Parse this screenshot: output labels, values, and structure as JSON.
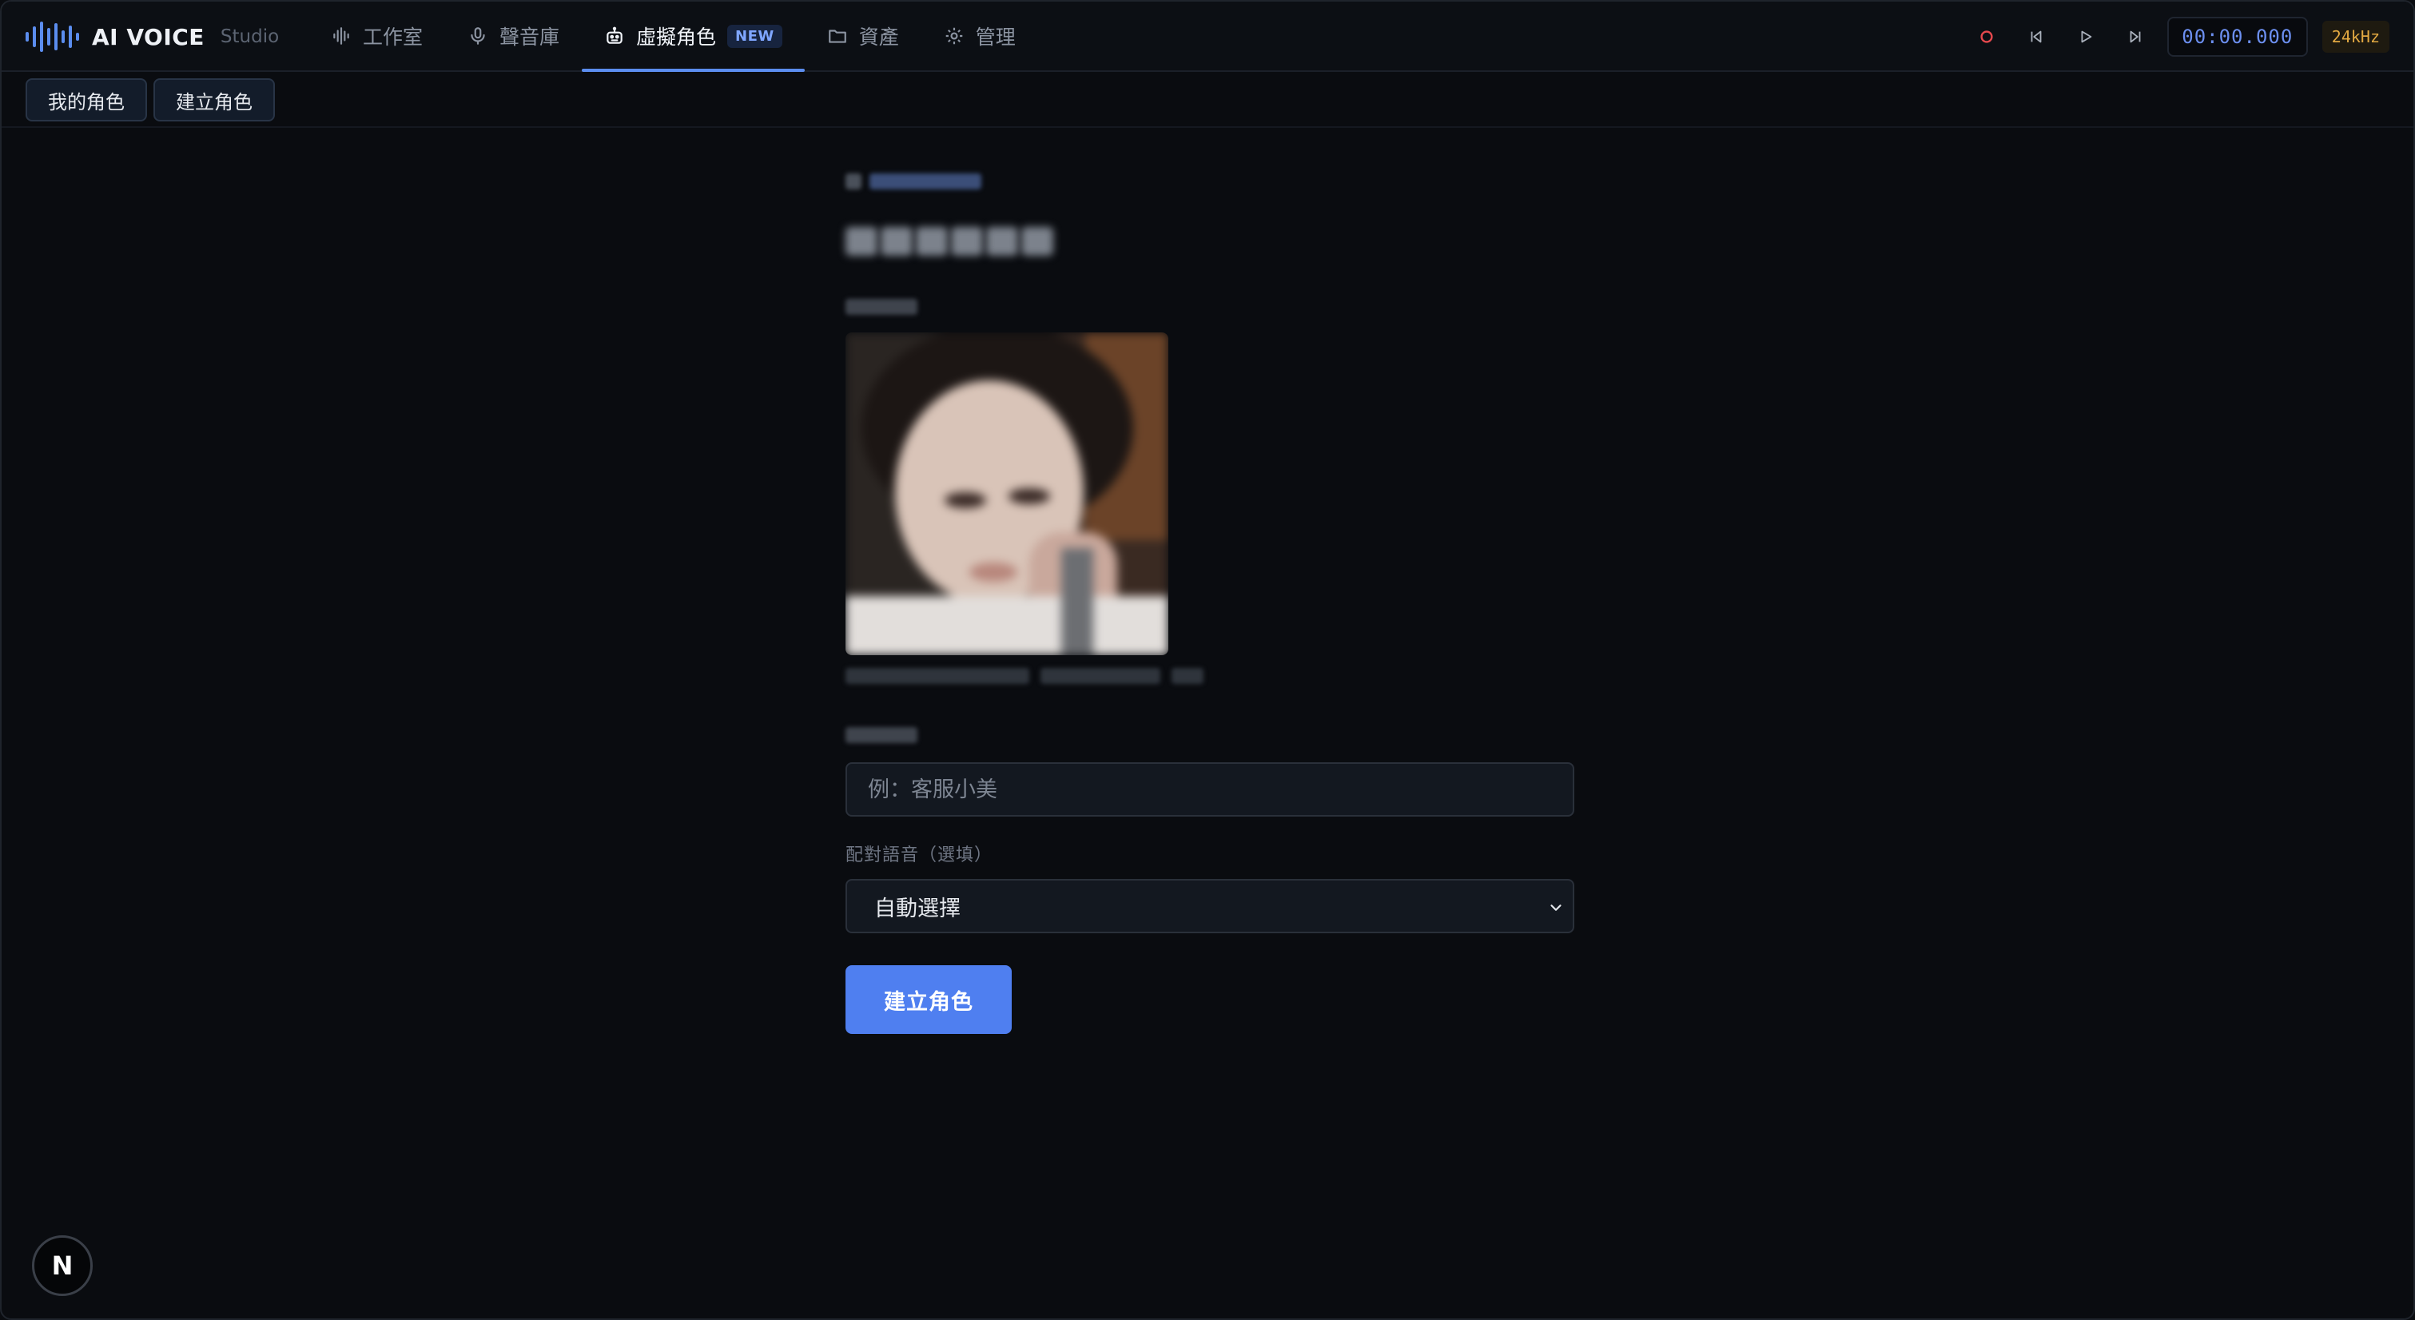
{
  "brand": {
    "name": "AI VOICE",
    "subtitle": "Studio",
    "accent": "#5b8def"
  },
  "nav": {
    "items": [
      {
        "label": "工作室",
        "icon": "waveform-icon",
        "active": false
      },
      {
        "label": "聲音庫",
        "icon": "microphone-icon",
        "active": false
      },
      {
        "label": "虛擬角色",
        "icon": "robot-icon",
        "active": true,
        "badge": "NEW"
      },
      {
        "label": "資產",
        "icon": "folder-icon",
        "active": false
      },
      {
        "label": "管理",
        "icon": "gear-icon",
        "active": false
      }
    ]
  },
  "transport": {
    "record_icon": "record-icon",
    "prev_icon": "skip-back-icon",
    "play_icon": "play-icon",
    "next_icon": "skip-forward-icon",
    "timecode": "00:00.000",
    "sample_rate": "24kHz",
    "record_color": "#e5484d"
  },
  "subtabs": [
    {
      "label": "我的角色"
    },
    {
      "label": "建立角色"
    }
  ],
  "form": {
    "name_placeholder": "例：客服小美",
    "name_value": "",
    "voice_label": "配對語音（選填）",
    "voice_selected": "自動選擇",
    "submit_label": "建立角色",
    "submit_color": "#4f7ff0"
  },
  "fab": {
    "label": "N"
  }
}
